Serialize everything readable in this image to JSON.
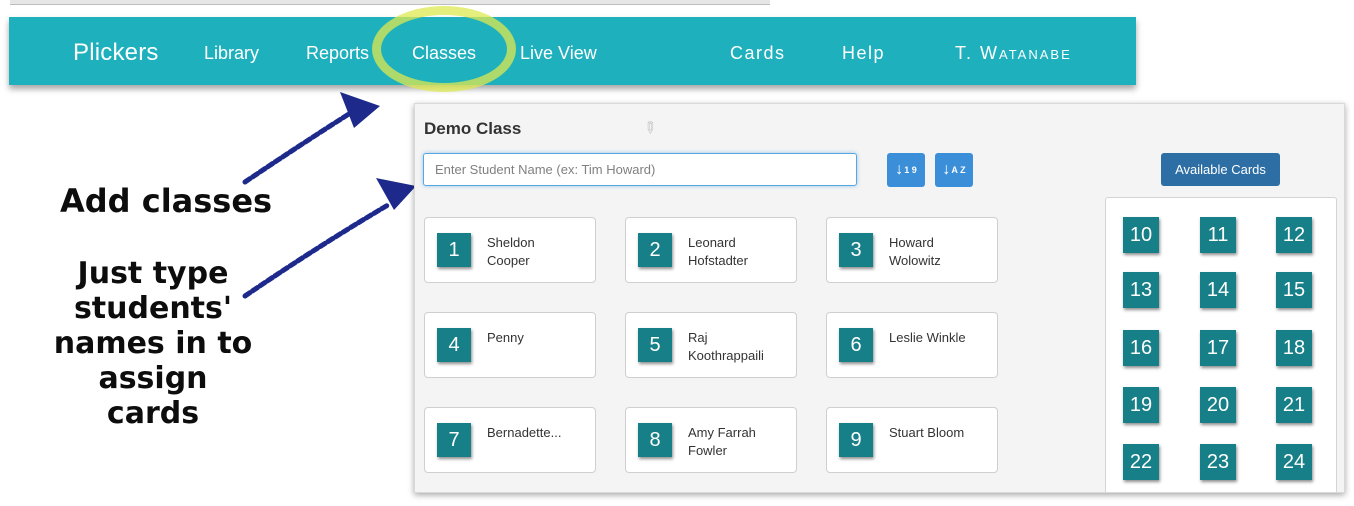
{
  "navbar": {
    "brand": "Plickers",
    "links": [
      "Library",
      "Reports",
      "Classes",
      "Live View"
    ],
    "right_links": [
      "Cards",
      "Help"
    ],
    "user": "T. Watanabe",
    "color": "#1fb0bd"
  },
  "annotations": {
    "add_classes": "Add classes",
    "type_names": "Just type students' names in to assign cards"
  },
  "panel": {
    "title": "Demo Class",
    "input_placeholder": "Enter Student Name (ex: Tim Howard)",
    "sort_numeric_label": "1 9",
    "sort_alpha_label": "A Z",
    "available_cards_label": "Available Cards",
    "available_cards": [
      "10",
      "11",
      "12",
      "13",
      "14",
      "15",
      "16",
      "17",
      "18",
      "19",
      "20",
      "21",
      "22",
      "23",
      "24"
    ],
    "students": [
      {
        "number": "1",
        "name": "Sheldon\nCooper"
      },
      {
        "number": "2",
        "name": "Leonard\nHofstadter"
      },
      {
        "number": "3",
        "name": "Howard\nWolowitz"
      },
      {
        "number": "4",
        "name": "Penny"
      },
      {
        "number": "5",
        "name": "Raj\nKoothrappaili"
      },
      {
        "number": "6",
        "name": "Leslie Winkle"
      },
      {
        "number": "7",
        "name": "Bernadette..."
      },
      {
        "number": "8",
        "name": "Amy Farrah\nFowler"
      },
      {
        "number": "9",
        "name": "Stuart Bloom"
      }
    ],
    "card_color": "#177f88",
    "button_color": "#3a8fd8"
  }
}
